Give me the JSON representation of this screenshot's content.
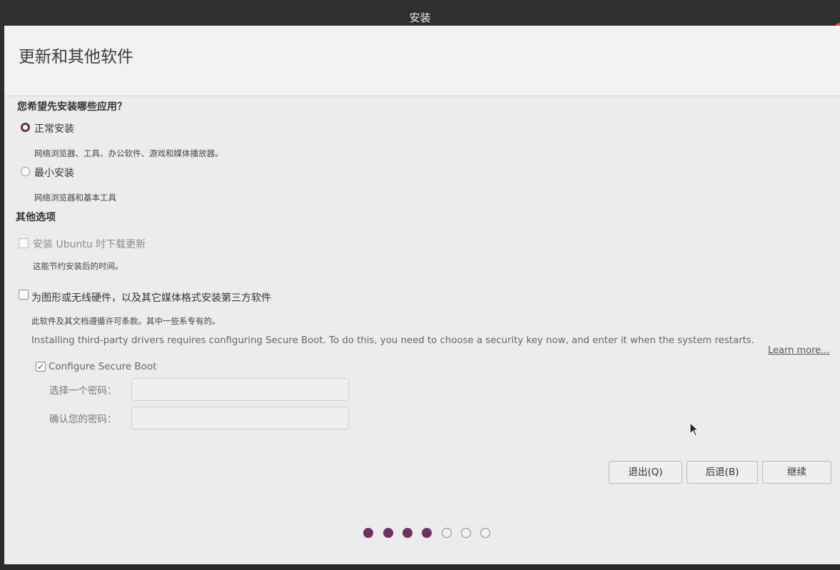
{
  "window": {
    "title": "安装"
  },
  "page": {
    "title": "更新和其他软件"
  },
  "install_type": {
    "question": "您希望先安装哪些应用？",
    "options": [
      {
        "label": "正常安装",
        "description": "网络浏览器、工具、办公软件、游戏和媒体播放器。",
        "selected": true
      },
      {
        "label": "最小安装",
        "description": "网络浏览器和基本工具",
        "selected": false
      }
    ]
  },
  "other_options": {
    "heading": "其他选项",
    "download_updates": {
      "label": "安装 Ubuntu 时下载更新",
      "description": "这能节约安装后的时间。",
      "checked": false,
      "enabled": false
    },
    "third_party": {
      "label": "为图形或无线硬件，以及其它媒体格式安装第三方软件",
      "description": "此软件及其文档遵循许可条款。其中一些系专有的。",
      "checked": false
    }
  },
  "secure_boot": {
    "notice": "Installing third-party drivers requires configuring Secure Boot. To do this, you need to choose a security key now, and enter it when the system restarts.",
    "learn_more": "Learn more...",
    "configure_label": "Configure Secure Boot",
    "configure_checked": true,
    "password_label": "选择一个密码：",
    "confirm_label": "确认您的密码："
  },
  "buttons": {
    "quit": "退出(Q)",
    "back": "后退(B)",
    "continue": "继续"
  },
  "progress": {
    "completed_steps": 4,
    "total_steps": 7
  },
  "colors": {
    "accent": "#6e3160",
    "titlebar": "#2f2f2f",
    "close": "#e95420"
  }
}
